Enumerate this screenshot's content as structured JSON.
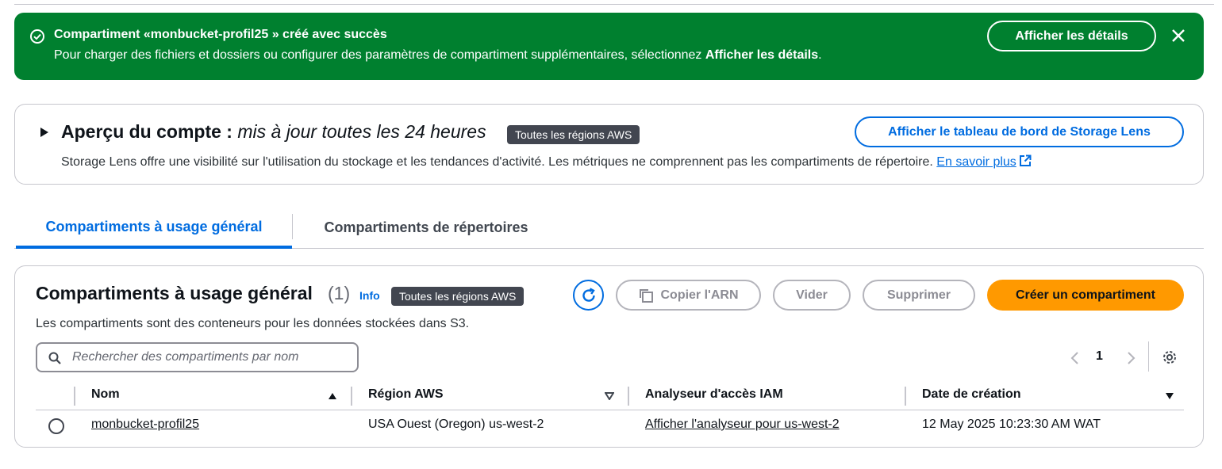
{
  "flash": {
    "title": "Compartiment «monbucket-profil25 » créé avec succès",
    "message_prefix": "Pour charger des fichiers et dossiers ou configurer des paramètres de compartiment supplémentaires, sélectionnez ",
    "message_bold": "Afficher les détails",
    "message_suffix": ".",
    "details_button": "Afficher les détails",
    "icon": "check-circle-icon",
    "close_icon": "close-icon",
    "color": "#00802f"
  },
  "overview": {
    "heading": "Aperçu du compte : ",
    "heading_italic": "mis à jour toutes les 24 heures",
    "badge": "Toutes les régions AWS",
    "description": "Storage Lens offre une visibilité sur l'utilisation du stockage et les tendances d'activité. Les métriques ne comprennent pas les compartiments de répertoire. ",
    "learn_more": "En savoir plus",
    "dashboard_button": "Afficher le tableau de bord de Storage Lens"
  },
  "tabs": [
    {
      "label": "Compartiments à usage général",
      "active": true
    },
    {
      "label": "Compartiments de répertoires",
      "active": false
    }
  ],
  "buckets": {
    "title": "Compartiments à usage général",
    "count": "(1)",
    "info": "Info",
    "badge": "Toutes les régions AWS",
    "description": "Les compartiments sont des conteneurs pour les données stockées dans S3.",
    "actions": {
      "copy_arn": "Copier l'ARN",
      "empty": "Vider",
      "delete": "Supprimer",
      "create": "Créer un compartiment"
    },
    "search_placeholder": "Rechercher des compartiments par nom",
    "page": "1",
    "columns": [
      "Nom",
      "Région AWS",
      "Analyseur d'accès IAM",
      "Date de création"
    ],
    "rows": [
      {
        "name": "monbucket-profil25",
        "region": "USA Ouest (Oregon) us-west-2",
        "analyzer": "Afficher l'analyseur pour us-west-2",
        "created": "12 May 2025 10:23:30 AM WAT"
      }
    ],
    "accent_color": "#006ce0",
    "create_color": "#ff9900"
  }
}
